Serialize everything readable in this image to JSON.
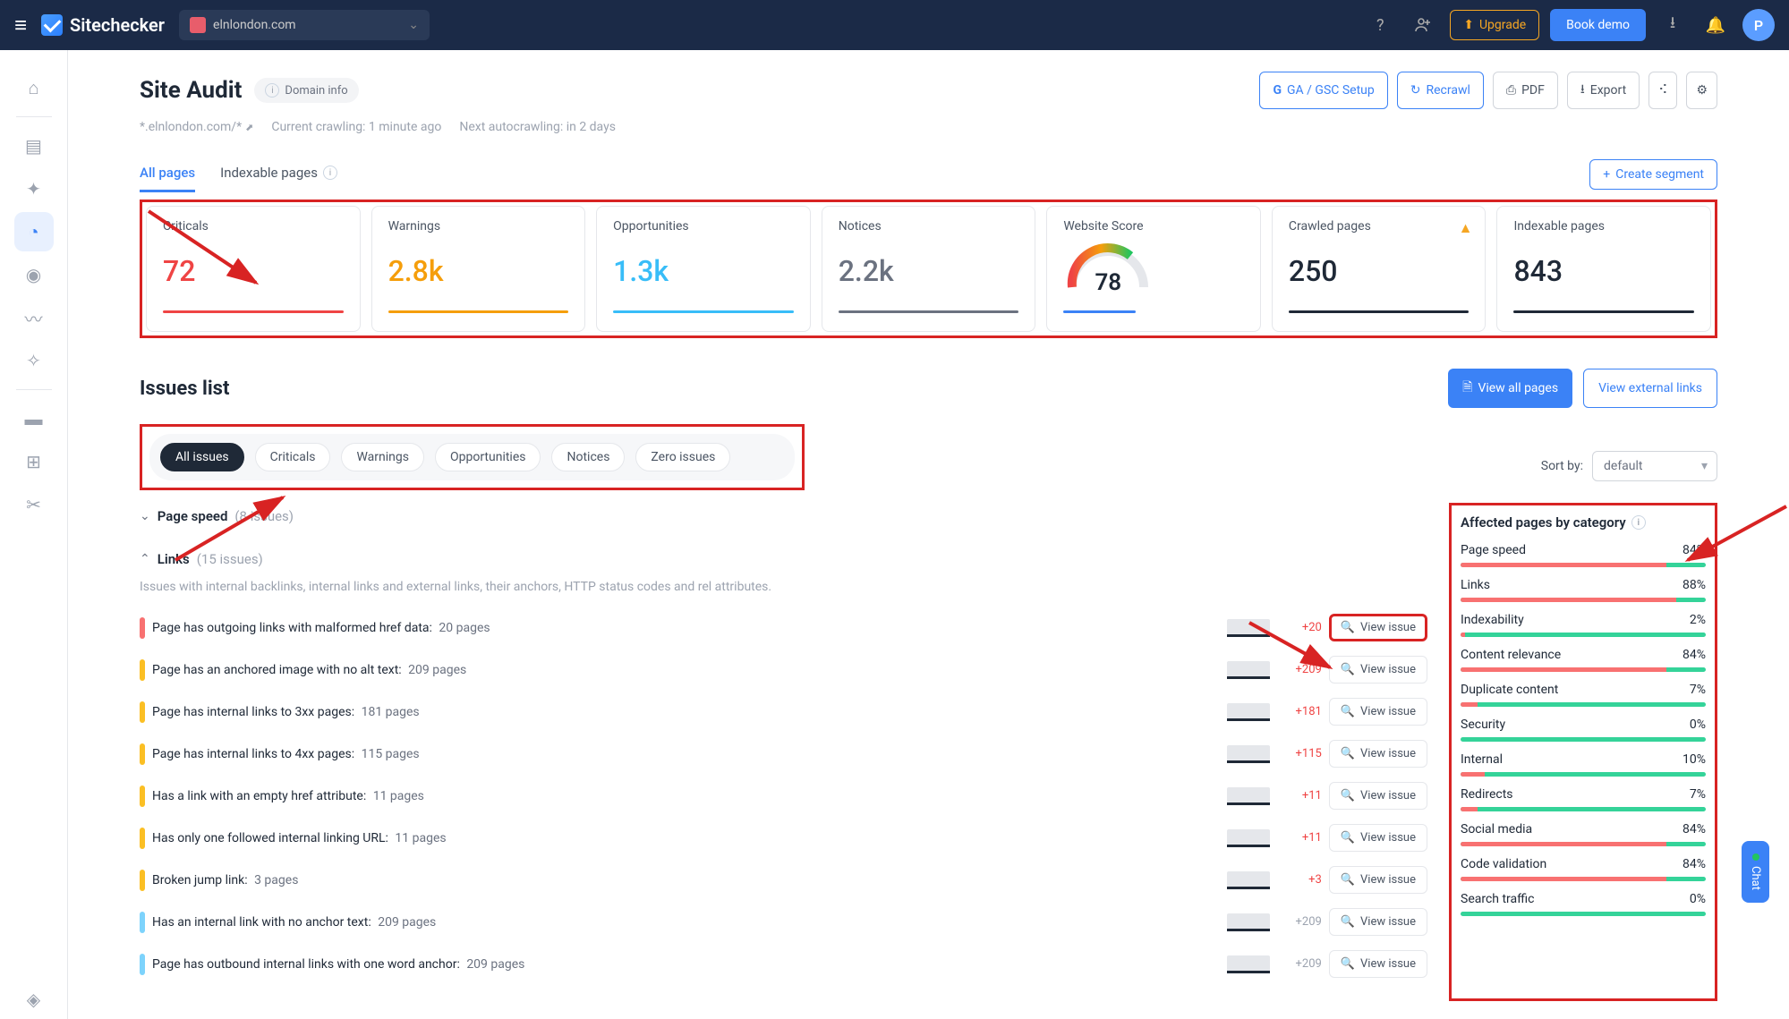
{
  "topbar": {
    "brand": "Sitechecker",
    "domain": "elnlondon.com",
    "upgrade": "Upgrade",
    "book": "Book demo",
    "avatar_letter": "P"
  },
  "page": {
    "title": "Site Audit",
    "domain_info": "Domain info",
    "scope": "*.elnlondon.com/*",
    "crawling_status": "Current crawling: 1 minute ago",
    "next_crawl": "Next autocrawling: in 2 days"
  },
  "header_buttons": {
    "ga": "GA / GSC Setup",
    "recrawl": "Recrawl",
    "pdf": "PDF",
    "export": "Export"
  },
  "tabs": {
    "all_pages": "All pages",
    "indexable": "Indexable pages",
    "create_segment": "Create segment"
  },
  "metrics": [
    {
      "label": "Criticals",
      "value": "72",
      "color": "#ef4444",
      "bar": "#ef4444"
    },
    {
      "label": "Warnings",
      "value": "2.8k",
      "color": "#f59e0b",
      "bar": "#f59e0b"
    },
    {
      "label": "Opportunities",
      "value": "1.3k",
      "color": "#38bdf8",
      "bar": "#38bdf8"
    },
    {
      "label": "Notices",
      "value": "2.2k",
      "color": "#6b7280",
      "bar": "#6b7280"
    },
    {
      "label": "Website Score",
      "value": "78",
      "gauge": true
    },
    {
      "label": "Crawled pages",
      "value": "250",
      "color": "#1f2937",
      "bar": "#1f2937",
      "warn": true
    },
    {
      "label": "Indexable pages",
      "value": "843",
      "color": "#1f2937",
      "bar": "#1f2937"
    }
  ],
  "issues": {
    "title": "Issues list",
    "view_all": "View all pages",
    "view_external": "View external links",
    "filters": [
      "All issues",
      "Criticals",
      "Warnings",
      "Opportunities",
      "Notices",
      "Zero issues"
    ],
    "sort_label": "Sort by:",
    "sort_value": "default",
    "groups": [
      {
        "name": "Page speed",
        "count": "(8 issues)",
        "expanded": false
      },
      {
        "name": "Links",
        "count": "(15 issues)",
        "expanded": true,
        "desc": "Issues with internal backlinks, internal links and external links, their anchors, HTTP status codes and rel attributes.",
        "rows": [
          {
            "sev": "red",
            "title": "Page has outgoing links with malformed href data:",
            "pages": "20 pages",
            "delta": "+20",
            "boxed": true
          },
          {
            "sev": "orange",
            "title": "Page has an anchored image with no alt text:",
            "pages": "209 pages",
            "delta": "+209"
          },
          {
            "sev": "orange",
            "title": "Page has internal links to 3xx pages:",
            "pages": "181 pages",
            "delta": "+181"
          },
          {
            "sev": "orange",
            "title": "Page has internal links to 4xx pages:",
            "pages": "115 pages",
            "delta": "+115"
          },
          {
            "sev": "orange",
            "title": "Has a link with an empty href attribute:",
            "pages": "11 pages",
            "delta": "+11"
          },
          {
            "sev": "orange",
            "title": "Has only one followed internal linking URL:",
            "pages": "11 pages",
            "delta": "+11"
          },
          {
            "sev": "orange",
            "title": "Broken jump link:",
            "pages": "3 pages",
            "delta": "+3"
          },
          {
            "sev": "teal",
            "title": "Has an internal link with no anchor text:",
            "pages": "209 pages",
            "delta": "+209",
            "gray": true
          },
          {
            "sev": "teal",
            "title": "Page has outbound internal links with one word anchor:",
            "pages": "209 pages",
            "delta": "+209",
            "gray": true
          }
        ],
        "view_label": "View issue"
      }
    ]
  },
  "affected": {
    "title": "Affected pages by category",
    "rows": [
      {
        "name": "Page speed",
        "pct": "84%"
      },
      {
        "name": "Links",
        "pct": "88%"
      },
      {
        "name": "Indexability",
        "pct": "2%"
      },
      {
        "name": "Content relevance",
        "pct": "84%"
      },
      {
        "name": "Duplicate content",
        "pct": "7%"
      },
      {
        "name": "Security",
        "pct": "0%"
      },
      {
        "name": "Internal",
        "pct": "10%"
      },
      {
        "name": "Redirects",
        "pct": "7%"
      },
      {
        "name": "Social media",
        "pct": "84%"
      },
      {
        "name": "Code validation",
        "pct": "84%"
      },
      {
        "name": "Search traffic",
        "pct": "0%"
      }
    ]
  },
  "chat": "Chat"
}
